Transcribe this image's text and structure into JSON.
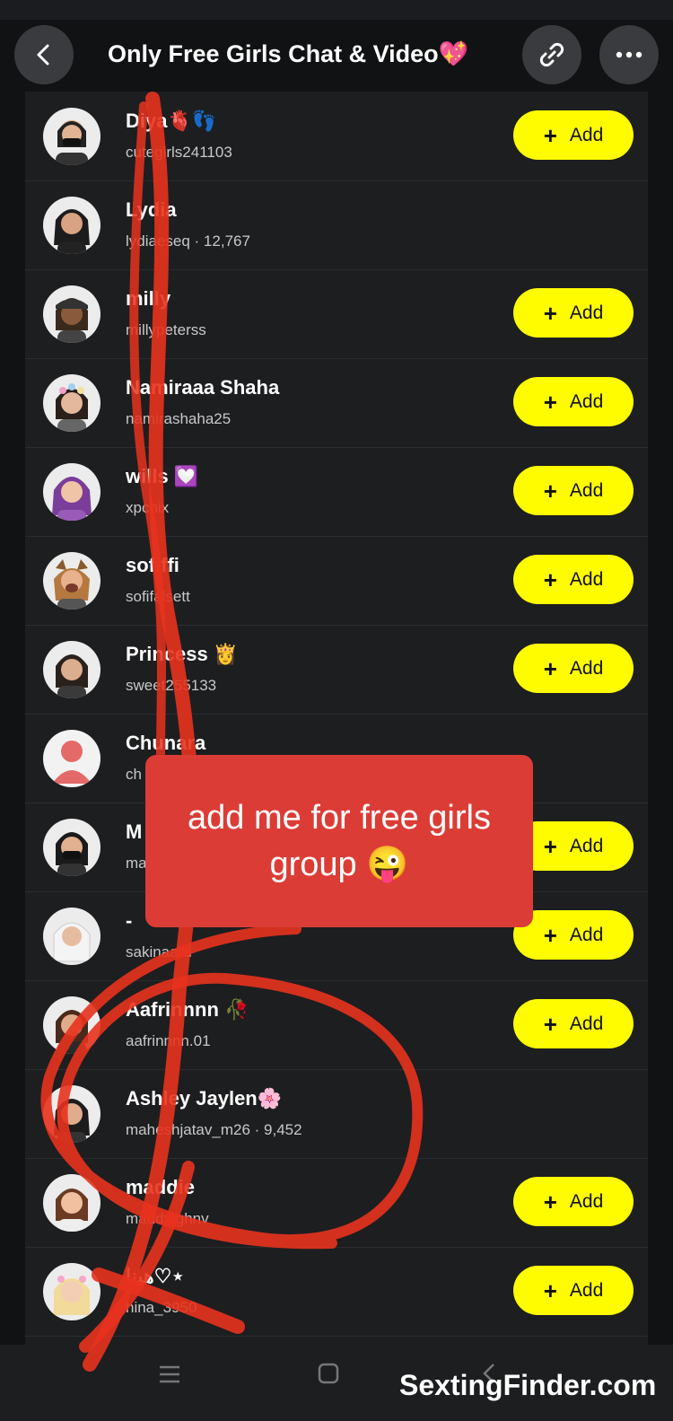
{
  "header": {
    "title": "Only Free Girls Chat & Video💖",
    "back_icon": "chevron-left-icon",
    "link_icon": "link-icon",
    "more_icon": "more-horizontal-icon"
  },
  "add_label": "Add",
  "rows": [
    {
      "name": "Diya🫀👣",
      "sub": "cutegirls241103",
      "add": true
    },
    {
      "name": "Lydia",
      "sub": "lydiaeseq · 12,767",
      "add": false
    },
    {
      "name": "milly",
      "sub": "millypeterss",
      "add": true
    },
    {
      "name": "Namiraaa Shaha",
      "sub": "namirashaha25",
      "add": true
    },
    {
      "name": "wills 💟",
      "sub": "xpchix",
      "add": true
    },
    {
      "name": "sofiffi",
      "sub": "sofifalsett",
      "add": true
    },
    {
      "name": "Princess 👸",
      "sub": "sweet255133",
      "add": true
    },
    {
      "name": "Chunara",
      "sub": "ch",
      "add": false
    },
    {
      "name": "M",
      "sub": "ma",
      "add": true
    },
    {
      "name": "-",
      "sub": "sakinaard",
      "add": true
    },
    {
      "name": "Aafrinnnn 🥀",
      "sub": "aafrinnnn.01",
      "add": true
    },
    {
      "name": "Ashley Jaylen🌸",
      "sub": "maheshjatav_m26 · 9,452",
      "add": false
    },
    {
      "name": "maddie",
      "sub": "maddytghnv",
      "add": true
    },
    {
      "name": "هينا♡⋆",
      "sub": "hina_3950",
      "add": true
    }
  ],
  "overlay": {
    "text": "add me for free girls group 😜"
  },
  "watermark": "SextingFinder.com",
  "colors": {
    "accent": "#fffc00",
    "overlay": "#dc3c36",
    "scribble": "#e8321e"
  }
}
